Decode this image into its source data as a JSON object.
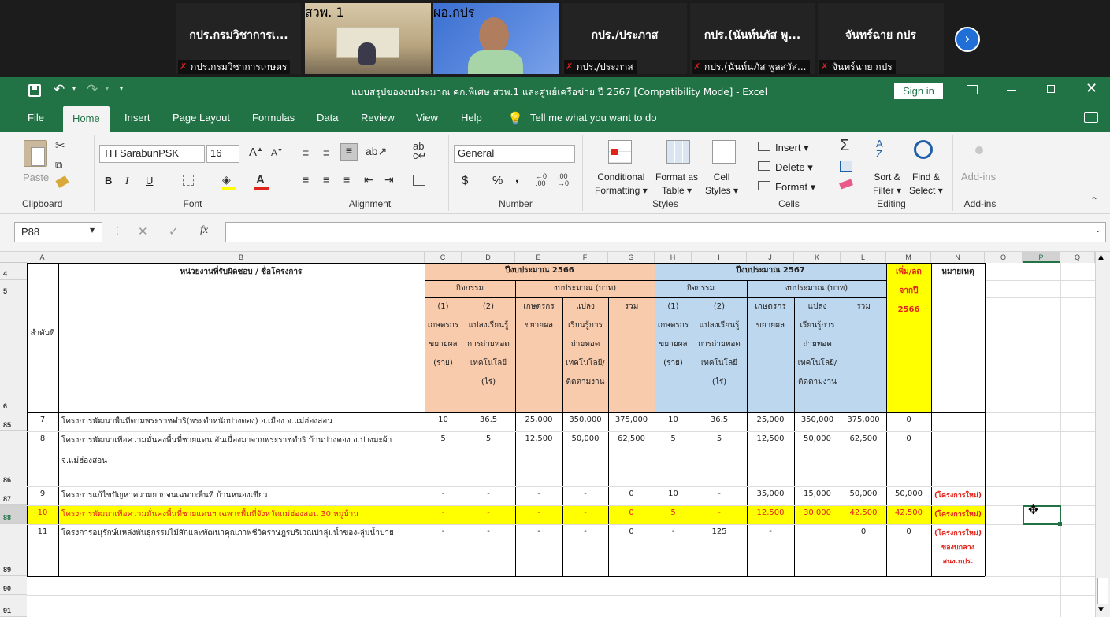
{
  "meeting": {
    "tiles": [
      {
        "name": "กปร.กรมวิชาการเ...",
        "label": "กปร.กรมวิชาการเกษตร"
      },
      {
        "name": "",
        "label": "สวพ. 1"
      },
      {
        "name": "",
        "label": "ผอ.กปร"
      },
      {
        "name": "กปร./ประภาส",
        "label": "กปร./ประภาส"
      },
      {
        "name": "กปร.(นันท์นภัส พู...",
        "label": "กปร.(นันท์นภัส พูลสวัส..."
      },
      {
        "name": "จันทร์ฉาย กปร",
        "label": "จันทร์ฉาย กปร"
      }
    ]
  },
  "titlebar": {
    "title": "แบบสรุปของงบประมาณ  คก.พิเศษ สวพ.1 และศูนย์เครือข่าย ปี 2567  [Compatibility Mode]  -  Excel",
    "sign_in": "Sign in"
  },
  "tabs": [
    "File",
    "Home",
    "Insert",
    "Page Layout",
    "Formulas",
    "Data",
    "Review",
    "View",
    "Help"
  ],
  "tell_me": "Tell me what you want to do",
  "ribbon": {
    "clipboard": {
      "paste": "Paste",
      "label": "Clipboard"
    },
    "font": {
      "name": "TH SarabunPSK",
      "size": "16",
      "label": "Font",
      "bold": "B",
      "italic": "I",
      "underline": "U"
    },
    "alignment": {
      "label": "Alignment"
    },
    "number": {
      "format": "General",
      "label": "Number",
      "currency": "$",
      "percent": "%",
      "comma": ","
    },
    "styles": {
      "cond1": "Conditional",
      "cond2": "Formatting",
      "table1": "Format as",
      "table2": "Table",
      "cell1": "Cell",
      "cell2": "Styles",
      "label": "Styles"
    },
    "cells": {
      "insert": "Insert",
      "delete": "Delete",
      "format": "Format",
      "label": "Cells"
    },
    "editing": {
      "sort1": "Sort &",
      "sort2": "Filter",
      "find1": "Find &",
      "find2": "Select",
      "label": "Editing"
    },
    "addins": {
      "btn": "Add-ins",
      "label": "Add-ins"
    }
  },
  "formula_bar": {
    "name_box": "P88",
    "fx": "fx",
    "content": ""
  },
  "columns": [
    "A",
    "B",
    "C",
    "D",
    "E",
    "F",
    "G",
    "H",
    "I",
    "J",
    "K",
    "L",
    "M",
    "N",
    "O",
    "P",
    "Q"
  ],
  "row_numbers": [
    "4",
    "5",
    "6",
    "85",
    "86",
    "87",
    "88",
    "89",
    "90",
    "91"
  ],
  "headers": {
    "unit": "หน่วยงานที่รับผิดชอบ / ชื่อโครงการ",
    "seq": "ลำดับที่",
    "fy2566": "ปีงบประมาณ 2566",
    "fy2567": "ปีงบประมาณ 2567",
    "activity": "กิจกรรม",
    "budget": "งบประมาณ (บาท)",
    "change": [
      "เพิ่ม/ลด",
      "จากปี",
      "2566"
    ],
    "remark": "หมายเหตุ",
    "sub1": [
      "(1)",
      "เกษตรกร",
      "ขยายผล",
      "(ราย)"
    ],
    "sub2": [
      "(2)",
      "แปลงเรียนรู้",
      "การถ่ายทอด",
      "เทคโนโลยี",
      "(ไร่)"
    ],
    "sub3": [
      "เกษตรกร",
      "ขยายผล"
    ],
    "sub4": [
      "แปลง",
      "เรียนรู้การ",
      "ถ่ายทอด",
      "เทคโนโลยี/",
      "ติดตามงาน"
    ],
    "sub5": "รวม"
  },
  "rows": [
    {
      "seq": "7",
      "name": "โครงการพัฒนาพื้นที่ตามพระราชดำริ(พระตำหนักปางตอง) อ.เมือง จ.แม่ฮ่องสอน",
      "name2": "",
      "c": "10",
      "d": "36.5",
      "e": "25,000",
      "f": "350,000",
      "g": "375,000",
      "h": "10",
      "i": "36.5",
      "j": "25,000",
      "k": "350,000",
      "l": "375,000",
      "m": "0",
      "n": ""
    },
    {
      "seq": "8",
      "name": "โครงการพัฒนาเพื่อความมั่นคงพื้นที่ชายแดน อันเนื่องมาจากพระราชดำริ บ้านปางตอง อ.ปางมะผ้า",
      "name2": "จ.แม่ฮ่องสอน",
      "c": "5",
      "d": "5",
      "e": "12,500",
      "f": "50,000",
      "g": "62,500",
      "h": "5",
      "i": "5",
      "j": "12,500",
      "k": "50,000",
      "l": "62,500",
      "m": "0",
      "n": ""
    },
    {
      "seq": "9",
      "name": "โครงการแก้ไขปัญหาความยากจนเฉพาะพื้นที่ บ้านหนองเขียว",
      "name2": "",
      "c": "-",
      "d": "-",
      "e": "-",
      "f": "-",
      "g": "0",
      "h": "10",
      "i": "-",
      "j": "35,000",
      "k": "15,000",
      "l": "50,000",
      "m": "50,000",
      "n": "(โครงการใหม่)"
    },
    {
      "seq": "10",
      "name": "โครงการพัฒนาเพื่อความมั่นคงพื้นที่ชายแดนฯ  เฉพาะพื้นที่จังหวัดแม่ฮ่องสอน 30 หมู่บ้าน",
      "name2": "",
      "c": "-",
      "d": "-",
      "e": "-",
      "f": "-",
      "g": "0",
      "h": "5",
      "i": "-",
      "j": "12,500",
      "k": "30,000",
      "l": "42,500",
      "m": "42,500",
      "n": "(โครงการใหม่)"
    },
    {
      "seq": "11",
      "name": "โครงการอนุรักษ์แหล่งพันธุกรรมไม้สักและพัฒนาคุณภาพชีวิตราษฎรบริเวณป่าลุ่มน้ำของ-ลุ่มน้ำปาย",
      "name2": "",
      "c": "-",
      "d": "-",
      "e": "-",
      "f": "-",
      "g": "0",
      "h": "-",
      "i": "125",
      "j": "-",
      "k": "",
      "l": "0",
      "m": "0",
      "n": "(โครงการใหม่)",
      "n2": "ของบกลาง",
      "n3": "สนง.กปร."
    }
  ],
  "colors": {
    "excel_green": "#217346",
    "orange_hdr": "#f8cbad",
    "blue_hdr": "#bdd7ee",
    "yellow": "#ffff00",
    "remark_red": "#e2231a"
  }
}
